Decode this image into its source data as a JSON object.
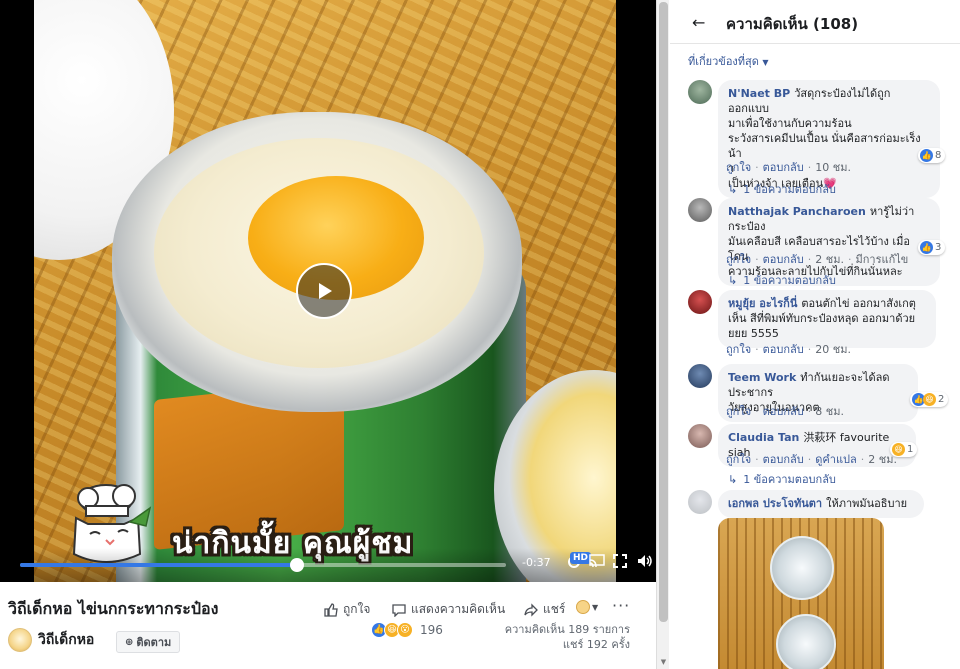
{
  "video": {
    "caption": "น่ากินมั้ย คุณผู้ชม",
    "progress_fraction": 0.57,
    "time_remaining": "-0:37",
    "hd_label": "HD"
  },
  "post": {
    "title": "วิถีเด็กหอ ไข่นกกระทากระป๋อง",
    "like_label": "ถูกใจ",
    "comment_label": "แสดงความคิดเห็น",
    "share_label": "แชร์",
    "page_name": "วิถีเด็กหอ",
    "follow_label": "ติดตาม",
    "reaction_count": "196",
    "comment_stats": "ความคิดเห็น 189 รายการ",
    "share_stats": "แชร์ 192 ครั้ง"
  },
  "comments_panel": {
    "title": "ความคิดเห็น (108)",
    "sort_label": "ที่เกี่ยวข้องที่สุด",
    "comments": [
      {
        "author": "N'Naet BP",
        "lines": [
          "วัสดุกระป๋องไม่ได้ถูกออกแบบ",
          "มาเพื่อใช้งานกับความร้อน",
          "ระวังสารเคมีปนเปื้อน นั่นคือสารก่อมะเร็งน้า",
          "า",
          "เป็นห่วงจ้า เลยเตือน💗"
        ],
        "like_label": "ถูกใจ",
        "reply_label": "ตอบกลับ",
        "time": "10 ชม.",
        "reaction_count": "8",
        "replies_label": "1 ข้อความตอบกลับ"
      },
      {
        "author": "Natthajak Pancharoen",
        "lines": [
          "หารู้ไม่ว่ากระป๋อง",
          "มันเคลือบสี เคลือบสารอะไรไว้บ้าง เมื่อโดน",
          "ความร้อนละลายไปกับไข่ที่กินนั่นหละ"
        ],
        "like_label": "ถูกใจ",
        "reply_label": "ตอบกลับ",
        "time": "2 ชม.",
        "edited_label": "มีการแก้ไข",
        "reaction_count": "3",
        "replies_label": "1 ข้อความตอบกลับ"
      },
      {
        "author": "หมูยุ้ย อะไรก็นี่",
        "lines": [
          "ตอนตักไข่ ออกมาสังเกตุ",
          "เห็น สีที่พิมพ์ทับกระป๋องหลุด ออกมาด้วย",
          "ยยย 5555"
        ],
        "like_label": "ถูกใจ",
        "reply_label": "ตอบกลับ",
        "time": "20 ชม."
      },
      {
        "author": "Teem Work",
        "lines": [
          "ทำกันเยอะจะได้ลดประชากร",
          "วัยสูงอายุในอนาคต"
        ],
        "like_label": "ถูกใจ",
        "reply_label": "ตอบกลับ",
        "time": "8 ชม.",
        "reaction_count": "2"
      },
      {
        "author": "Claudia Tan",
        "lines": [
          "洪萩环 favourite siah"
        ],
        "like_label": "ถูกใจ",
        "reply_label": "ตอบกลับ",
        "translate_label": "ดูคำแปล",
        "time": "2 ชม.",
        "reaction_count": "1",
        "replies_label": "1 ข้อความตอบกลับ"
      },
      {
        "author": "เอกพล ประโจทันตา",
        "lines": [
          "ให้ภาพมันอธิบาย"
        ]
      }
    ]
  },
  "colors": {
    "link": "#385898",
    "like_blue": "#3578e5",
    "bubble": "#f2f3f5",
    "love_red": "#f33e58",
    "haha_yellow": "#f7b125"
  }
}
